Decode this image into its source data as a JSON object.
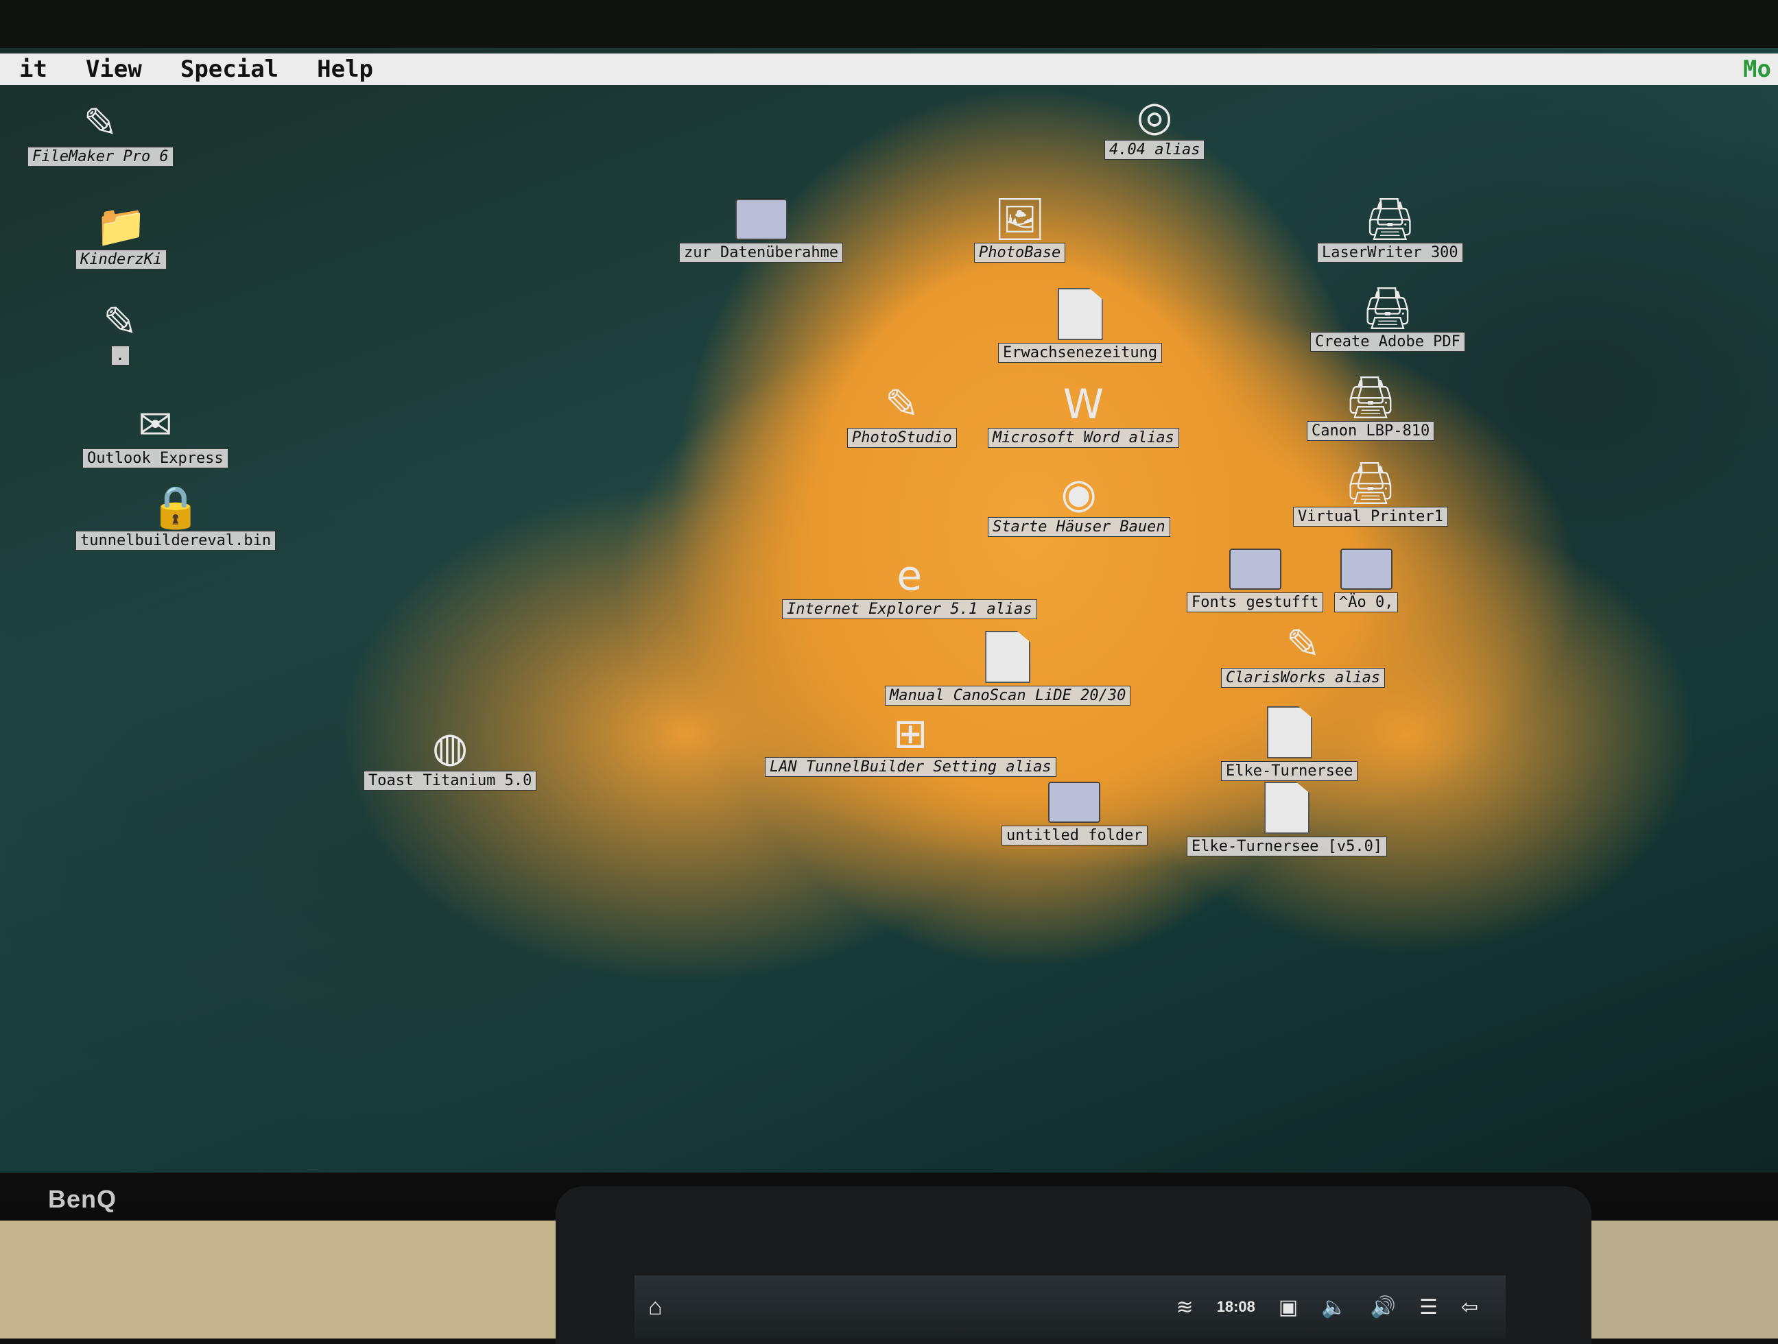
{
  "menubar": {
    "items": [
      "it",
      "View",
      "Special",
      "Help"
    ],
    "right_text": "Mo"
  },
  "monitor_brand": "BenQ",
  "tablet": {
    "time": "18:08"
  },
  "icons": [
    {
      "name": "filemaker-pro-6-icon",
      "label": "FileMaker Pro 6",
      "glyph": "✎",
      "italic": true
    },
    {
      "name": "kinderzki-icon",
      "label": "KinderzKi",
      "glyph": "📁",
      "italic": true
    },
    {
      "name": "dot-file-icon",
      "label": ".",
      "glyph": "✎",
      "italic": false
    },
    {
      "name": "outlook-express-icon",
      "label": "Outlook Express",
      "glyph": "✉",
      "italic": false
    },
    {
      "name": "tunnelbuildereval-bin-icon",
      "label": "tunnelbuildereval.bin",
      "glyph": "🔒",
      "italic": false
    },
    {
      "name": "alias-404-icon",
      "label": "4.04 alias",
      "glyph": "◎",
      "italic": true
    },
    {
      "name": "zur-datenuebernahme-icon",
      "label": "zur Datenüberahme",
      "glyph": "folder",
      "italic": false
    },
    {
      "name": "photobase-icon",
      "label": "PhotoBase",
      "glyph": "🖼",
      "italic": true
    },
    {
      "name": "laserwriter-300-icon",
      "label": "LaserWriter 300",
      "glyph": "🖨",
      "italic": false
    },
    {
      "name": "erwachsenezeitung-icon",
      "label": "Erwachsenezeitung",
      "glyph": "doc",
      "italic": false
    },
    {
      "name": "create-adobe-pdf-icon",
      "label": "Create Adobe PDF",
      "glyph": "🖨",
      "italic": false
    },
    {
      "name": "photostudio-icon",
      "label": "PhotoStudio",
      "glyph": "✎",
      "italic": true
    },
    {
      "name": "microsoft-word-alias-icon",
      "label": "Microsoft Word alias",
      "glyph": "W",
      "italic": true
    },
    {
      "name": "canon-lbp-810-icon",
      "label": "Canon LBP-810",
      "glyph": "🖨",
      "italic": false
    },
    {
      "name": "starte-haeuser-bauen-icon",
      "label": "Starte Häuser Bauen",
      "glyph": "◉",
      "italic": true
    },
    {
      "name": "virtual-printer1-icon",
      "label": "Virtual Printer1",
      "glyph": "🖨",
      "italic": false
    },
    {
      "name": "internet-explorer-icon",
      "label": "Internet Explorer 5.1 alias",
      "glyph": "e",
      "italic": true
    },
    {
      "name": "fonts-gestufft-icon",
      "label": "Fonts gestufft",
      "glyph": "folder",
      "italic": false
    },
    {
      "name": "ao-folder-icon",
      "label": "^Äo 0,",
      "glyph": "folder",
      "italic": false
    },
    {
      "name": "manual-canoscan-icon",
      "label": "Manual CanoScan LiDE 20/30",
      "glyph": "doc",
      "italic": true
    },
    {
      "name": "clarisworks-alias-icon",
      "label": "ClarisWorks alias",
      "glyph": "✎",
      "italic": true
    },
    {
      "name": "toast-titanium-icon",
      "label": "Toast Titanium 5.0",
      "glyph": "◍",
      "italic": false
    },
    {
      "name": "lan-tunnelbuilder-icon",
      "label": "LAN TunnelBuilder Setting alias",
      "glyph": "⊞",
      "italic": true
    },
    {
      "name": "elke-turnersee-icon",
      "label": "Elke-Turnersee",
      "glyph": "doc",
      "italic": false
    },
    {
      "name": "untitled-folder-icon",
      "label": "untitled folder",
      "glyph": "folder",
      "italic": false
    },
    {
      "name": "elke-turnersee-v50-icon",
      "label": "Elke-Turnersee [v5.0]",
      "glyph": "doc",
      "italic": false
    }
  ]
}
